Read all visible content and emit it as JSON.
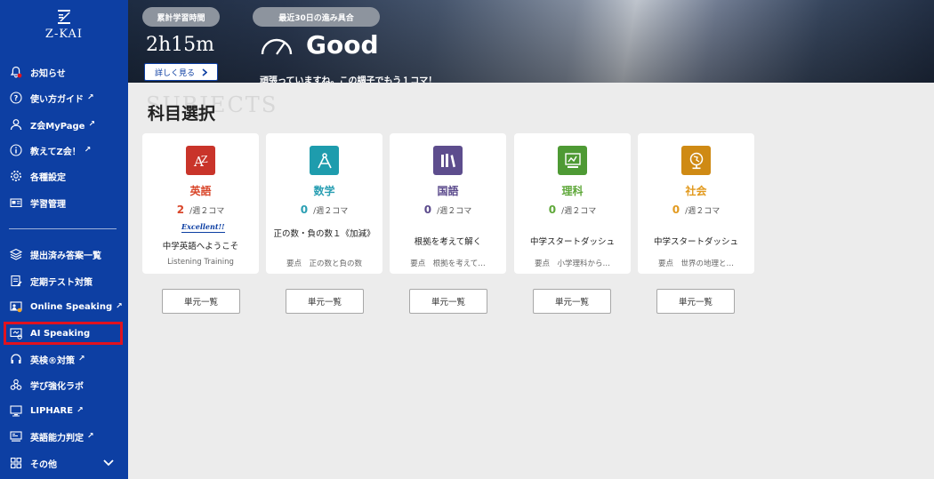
{
  "sidebar": {
    "logo": "Z-KAI",
    "items": [
      {
        "label": "お知らせ",
        "icon": "bell-icon",
        "ext": ""
      },
      {
        "label": "使い方ガイド",
        "icon": "question-icon",
        "ext": "↗"
      },
      {
        "label": "Z会MyPage",
        "icon": "person-icon",
        "ext": "↗"
      },
      {
        "label": "教えてZ会！",
        "icon": "info-icon",
        "ext": "↗"
      },
      {
        "label": "各種設定",
        "icon": "gear-icon",
        "ext": ""
      },
      {
        "label": "学習管理",
        "icon": "id-card-icon",
        "ext": ""
      },
      {
        "label": "提出済み答案一覧",
        "icon": "layers-icon",
        "ext": ""
      },
      {
        "label": "定期テスト対策",
        "icon": "clipboard-icon",
        "ext": ""
      },
      {
        "label": "Online Speaking",
        "icon": "person-chat-icon",
        "ext": "↗"
      },
      {
        "label": "AI Speaking",
        "icon": "monitor-chat-icon",
        "ext": ""
      },
      {
        "label": "英検®対策",
        "icon": "headset-icon",
        "ext": "↗"
      },
      {
        "label": "学び強化ラボ",
        "icon": "molecule-icon",
        "ext": ""
      },
      {
        "label": "LIPHARE",
        "icon": "screen-icon",
        "ext": "↗"
      },
      {
        "label": "英語能力判定",
        "icon": "computer-icon",
        "ext": "↗"
      },
      {
        "label": "その他",
        "icon": "grid-icon",
        "ext": ""
      }
    ]
  },
  "banner": {
    "total_time_label": "累計学習時間",
    "total_time_value": "2h15m",
    "detail_button": "詳しく見る",
    "progress_label": "最近30日の進み具合",
    "status": "Good",
    "message": "頑張っていますね。この調子でもう１コマ！"
  },
  "main": {
    "bg_label": "SUBJECTS",
    "title": "科目選択",
    "unit_button": "単元一覧",
    "cards": [
      {
        "name": "英語",
        "count": "2",
        "per": "/週２コマ",
        "badge": "Excellent!!",
        "lesson": "中学英語へようこそ",
        "sub": "Listening Training",
        "color": "#d9472b",
        "icon_color": "#c9342a"
      },
      {
        "name": "数学",
        "count": "0",
        "per": "/週２コマ",
        "badge": "",
        "lesson": "正の数・負の数１《加減》",
        "sub": "要点　正の数と負の数",
        "color": "#2a9fb3",
        "icon_color": "#1e9cad"
      },
      {
        "name": "国語",
        "count": "0",
        "per": "/週２コマ",
        "badge": "",
        "lesson": "根拠を考えて解く",
        "sub": "要点　根拠を考えて…",
        "color": "#5b4a8c",
        "icon_color": "#5d4d8d"
      },
      {
        "name": "理科",
        "count": "0",
        "per": "/週２コマ",
        "badge": "",
        "lesson": "中学スタートダッシュ",
        "sub": "要点　小学理科から…",
        "color": "#5fa83a",
        "icon_color": "#4e9a34"
      },
      {
        "name": "社会",
        "count": "0",
        "per": "/週２コマ",
        "badge": "",
        "lesson": "中学スタートダッシュ",
        "sub": "要点　世界の地理と…",
        "color": "#e29a1f",
        "icon_color": "#cf8a14"
      }
    ]
  }
}
